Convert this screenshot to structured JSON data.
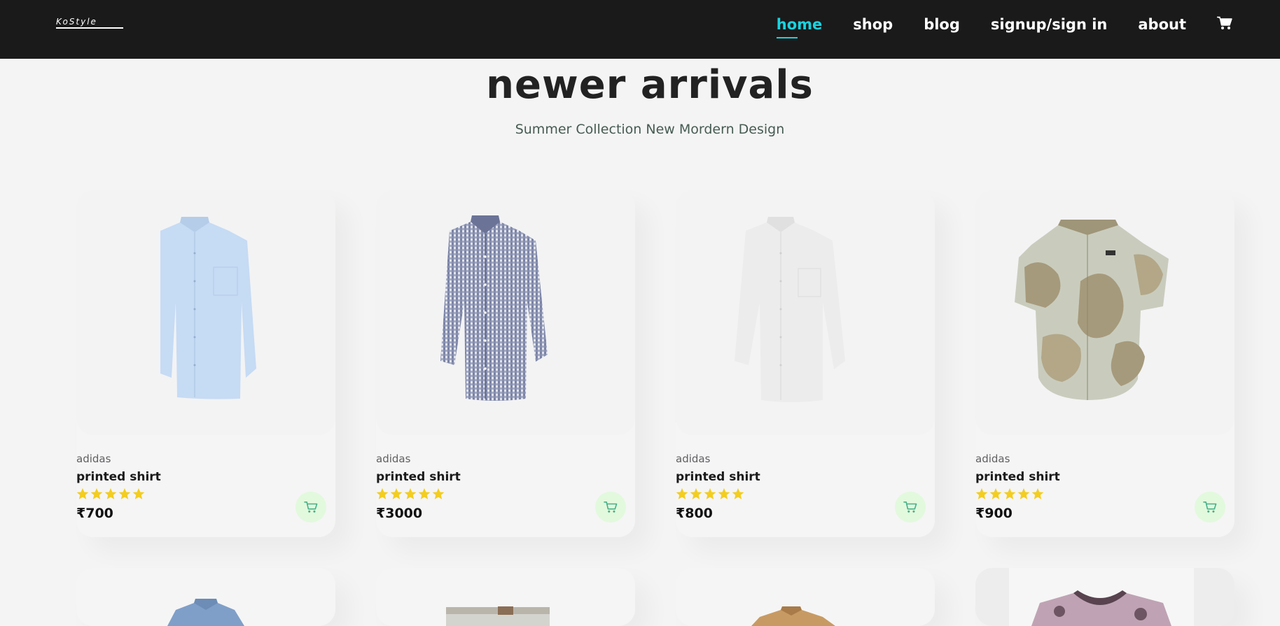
{
  "nav": {
    "logo_text": "KoStyle",
    "links": [
      {
        "label": "home",
        "active": true
      },
      {
        "label": "shop",
        "active": false
      },
      {
        "label": "blog",
        "active": false
      },
      {
        "label": "signup/sign in",
        "active": false
      },
      {
        "label": "about",
        "active": false
      }
    ],
    "cart_icon": "shopping-cart-icon"
  },
  "section": {
    "title": "newer arrivals",
    "subtitle": "Summer Collection New Mordern Design"
  },
  "products": [
    {
      "brand": "adidas",
      "name": "printed shirt",
      "rating": 5,
      "price": "₹700",
      "image": "light-blue-shirt"
    },
    {
      "brand": "adidas",
      "name": "printed shirt",
      "rating": 5,
      "price": "₹3000",
      "image": "navy-gingham-shirt"
    },
    {
      "brand": "adidas",
      "name": "printed shirt",
      "rating": 5,
      "price": "₹800",
      "image": "white-shirt"
    },
    {
      "brand": "adidas",
      "name": "printed shirt",
      "rating": 5,
      "price": "₹900",
      "image": "printed-short-sleeve-shirt"
    }
  ],
  "colors": {
    "navbar_bg": "#1a1a1a",
    "active_link": "#19d3e0",
    "star": "#f3cd20",
    "cart_button_bg": "#e2f9dd",
    "cart_button_icon": "#46b088",
    "page_bg": "#f4f4f4"
  }
}
